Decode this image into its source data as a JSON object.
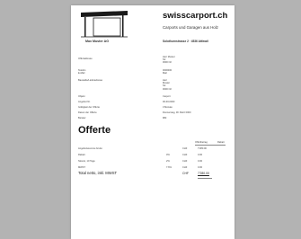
{
  "company": {
    "name": "Max Muster AG",
    "brand": "swisscarport.ch",
    "tagline": "Carports und Garagen aus Holz",
    "address": "Solothurnstrasse 2 · 4536 Attiswil"
  },
  "customer": {
    "label": "Offertadresse",
    "lines": [
      "Herr Muster",
      "Str.",
      "0000 Ort"
    ]
  },
  "contact": {
    "labels": [
      "Telefon",
      "E-Mail"
    ],
    "values": [
      "0000000",
      "Mail"
    ]
  },
  "delivery": {
    "label": "Baustelle/Lieferadresse",
    "lines": [
      "Herr",
      "Muster",
      "Str.",
      "0000 Ort"
    ]
  },
  "meta": [
    {
      "label": "Objekt",
      "value": "Carport"
    },
    {
      "label": "Angebot Nr.",
      "value": "00-00-0000"
    },
    {
      "label": "Gültigkeit der Offerte",
      "value": "3 Monate"
    },
    {
      "label": "Datum der Offerte",
      "value": "Donnerstag, 00. März 0000"
    },
    {
      "label": "Berater",
      "value": "MM"
    }
  ],
  "title": "Offerte",
  "table": {
    "headers": [
      "Offertbetrag",
      "Rabatt"
    ],
    "rows": [
      {
        "label": "Angebotssumme brutto",
        "qty": "",
        "curr": "CHF",
        "amount": "7'280.00"
      },
      {
        "label": "Rabatt",
        "qty": "0%",
        "curr": "CHF",
        "amount": "0.00"
      },
      {
        "label": "Skonto, 10 Tage",
        "qty": "2%",
        "curr": "CHF",
        "amount": "0.00"
      },
      {
        "label": "MWST",
        "qty": "7.6%",
        "curr": "CHF",
        "amount": "0.00"
      }
    ]
  },
  "total": {
    "label": "Total netto, inkl. MWST",
    "currency": "CHF",
    "amount": "7'280.00"
  }
}
